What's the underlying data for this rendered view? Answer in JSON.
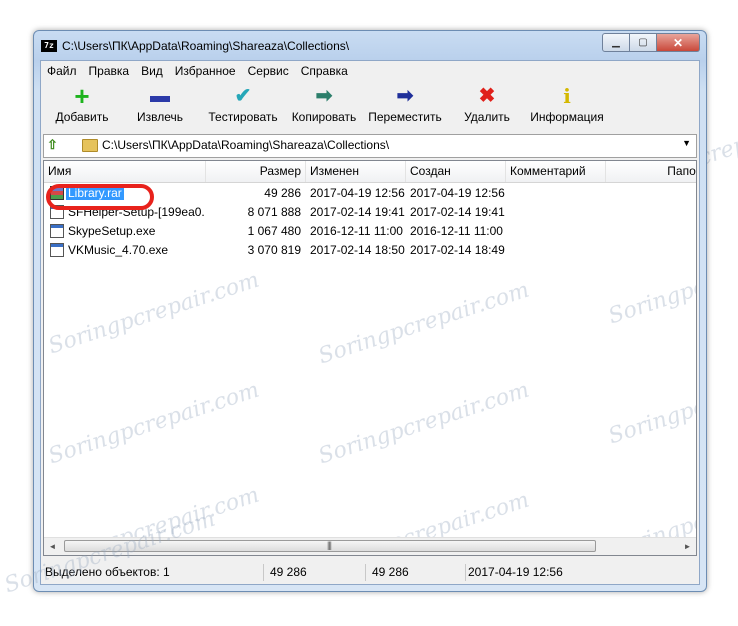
{
  "window": {
    "title": "C:\\Users\\ПК\\AppData\\Roaming\\Shareaza\\Collections\\",
    "app_icon": "7z",
    "buttons": {
      "minimize": "▁",
      "maximize": "▢",
      "close": "✕"
    }
  },
  "menu": [
    "Файл",
    "Правка",
    "Вид",
    "Избранное",
    "Сервис",
    "Справка"
  ],
  "toolbar": [
    {
      "label": "Добавить",
      "icon": "+",
      "icon_name": "add-icon",
      "color": "#1db31d"
    },
    {
      "label": "Извлечь",
      "icon": "▬",
      "icon_name": "extract-icon",
      "color": "#2b3aa8"
    },
    {
      "label": "Тестировать",
      "icon": "✔",
      "icon_name": "test-icon",
      "color": "#26a7b8"
    },
    {
      "label": "Копировать",
      "icon": "➡",
      "icon_name": "copy-icon",
      "color": "#2c7f6b"
    },
    {
      "label": "Переместить",
      "icon": "➡",
      "icon_name": "move-icon",
      "color": "#1f2f9a"
    },
    {
      "label": "Удалить",
      "icon": "✖",
      "icon_name": "delete-icon",
      "color": "#e0201a"
    },
    {
      "label": "Информация",
      "icon": "i",
      "icon_name": "info-icon",
      "color": "#d4b800"
    }
  ],
  "address": {
    "path": "C:\\Users\\ПК\\AppData\\Roaming\\Shareaza\\Collections\\",
    "dropdown": "▼",
    "up": "⇧"
  },
  "columns": [
    "Имя",
    "Размер",
    "Изменен",
    "Создан",
    "Комментарий",
    "Папок"
  ],
  "files": [
    {
      "name": "Library.rar",
      "size": "49 286",
      "modified": "2017-04-19 12:56",
      "created": "2017-04-19 12:56",
      "type": "rar",
      "selected": true
    },
    {
      "name": "SFHelper-Setup-[199ea0...",
      "size": "8 071 888",
      "modified": "2017-02-14 19:41",
      "created": "2017-02-14 19:41",
      "type": "exe",
      "selected": false
    },
    {
      "name": "SkypeSetup.exe",
      "size": "1 067 480",
      "modified": "2016-12-11 11:00",
      "created": "2016-12-11 11:00",
      "type": "exe",
      "selected": false
    },
    {
      "name": "VKMusic_4.70.exe",
      "size": "3 070 819",
      "modified": "2017-02-14 18:50",
      "created": "2017-02-14 18:49",
      "type": "exe",
      "selected": false
    }
  ],
  "scroll": {
    "left": "◄",
    "right": "►",
    "grip": "|||"
  },
  "status": {
    "selected": "Выделено объектов: 1",
    "size": "49 286",
    "packed": "49 286",
    "date": "2017-04-19 12:56"
  },
  "watermark": "Soringpcrepair.com",
  "accent": {
    "selection": "#3399ff",
    "highlight_circle": "#e8221c"
  }
}
